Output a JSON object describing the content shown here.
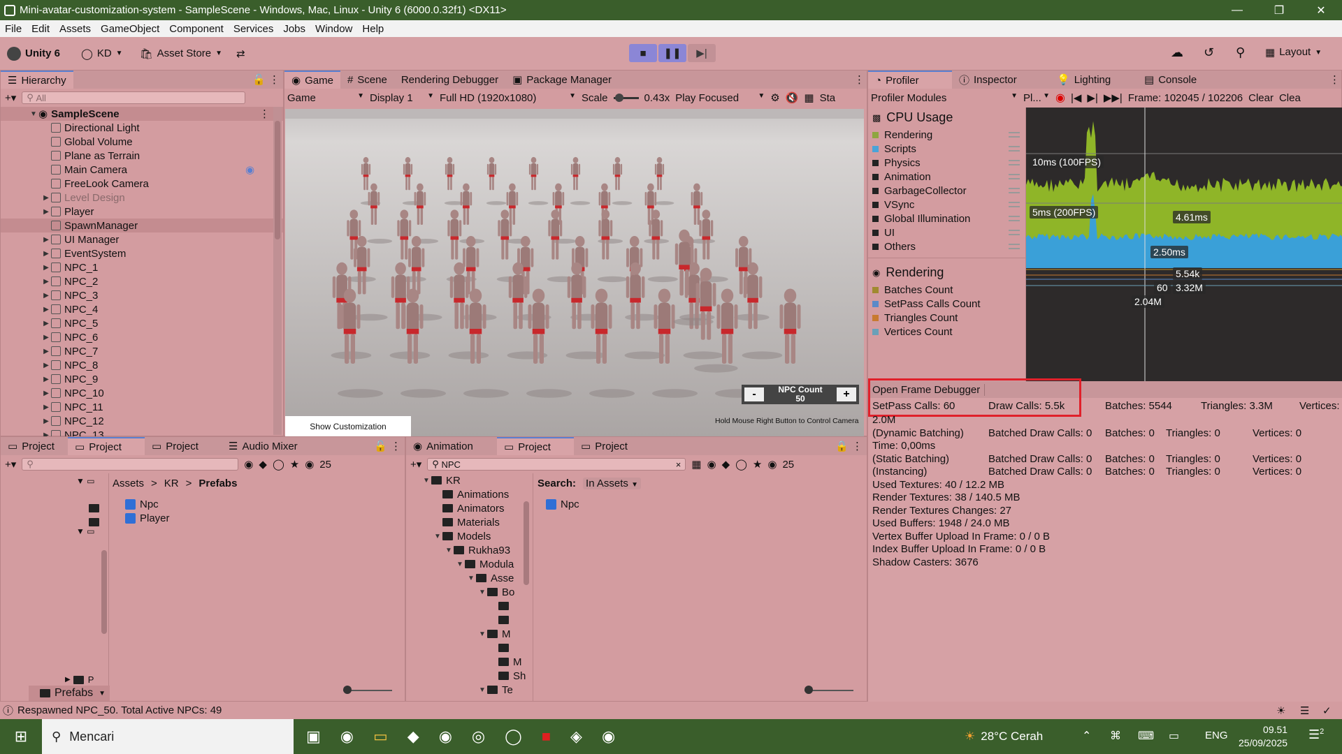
{
  "window": {
    "title": "Mini-avatar-customization-system - SampleScene - Windows, Mac, Linux - Unity 6 (6000.0.32f1) <DX11>"
  },
  "menu": [
    "File",
    "Edit",
    "Assets",
    "GameObject",
    "Component",
    "Services",
    "Jobs",
    "Window",
    "Help"
  ],
  "toolbar": {
    "unity_label": "Unity 6",
    "account": "KD",
    "asset_store": "Asset Store",
    "layout": "Layout"
  },
  "hierarchy": {
    "tab": "Hierarchy",
    "search_placeholder": "All",
    "scene": "SampleScene",
    "items": [
      "Directional Light",
      "Global Volume",
      "Plane as Terrain",
      "Main Camera",
      "FreeLook Camera",
      "Level Design",
      "Player",
      "SpawnManager",
      "UI Manager",
      "EventSystem",
      "NPC_1",
      "NPC_2",
      "NPC_3",
      "NPC_4",
      "NPC_5",
      "NPC_6",
      "NPC_7",
      "NPC_8",
      "NPC_9",
      "NPC_10",
      "NPC_11",
      "NPC_12",
      "NPC_13"
    ]
  },
  "center_tabs": [
    "Game",
    "Scene",
    "Rendering Debugger",
    "Package Manager"
  ],
  "game_bar": {
    "display_mode": "Game",
    "display": "Display 1",
    "resolution": "Full HD (1920x1080)",
    "scale_label": "Scale",
    "scale_value": "0.43x",
    "play_mode": "Play Focused",
    "stats": "Sta"
  },
  "game_overlay": {
    "npc_label": "NPC Count",
    "npc_value": "50",
    "minus": "-",
    "plus": "+",
    "show_btn": "Show Customization",
    "hint": "Hold Mouse Right Button to Control Camera"
  },
  "right_tabs": [
    "Profiler",
    "Inspector",
    "Lighting",
    "Console"
  ],
  "profiler": {
    "modules": "Profiler Modules",
    "pl": "Pl...",
    "frame": "Frame: 102045 / 102206",
    "clear": "Clear",
    "clear2": "Clea",
    "cpu_title": "CPU Usage",
    "cpu_items": [
      {
        "name": "Rendering",
        "color": "#8ea640"
      },
      {
        "name": "Scripts",
        "color": "#4aa3d8"
      },
      {
        "name": "Physics",
        "color": "#222222"
      },
      {
        "name": "Animation",
        "color": "#222222"
      },
      {
        "name": "GarbageCollector",
        "color": "#222222"
      },
      {
        "name": "VSync",
        "color": "#222222"
      },
      {
        "name": "Global Illumination",
        "color": "#222222"
      },
      {
        "name": "UI",
        "color": "#222222"
      },
      {
        "name": "Others",
        "color": "#222222"
      }
    ],
    "render_title": "Rendering",
    "render_items": [
      {
        "name": "Batches Count",
        "color": "#a08a30"
      },
      {
        "name": "SetPass Calls Count",
        "color": "#5a8ac8"
      },
      {
        "name": "Triangles Count",
        "color": "#c87a30"
      },
      {
        "name": "Vertices Count",
        "color": "#6aa0b8"
      }
    ],
    "chart_labels": {
      "l100": "10ms (100FPS)",
      "l200": "5ms (200FPS)",
      "v461": "4.61ms",
      "v250": "2.50ms",
      "v554": "5.54k",
      "v60": "60",
      "v332": "3.32M",
      "v204": "2.04M"
    },
    "open_fd": "Open Frame Debugger",
    "setpass": "SetPass Calls: 60",
    "drawcalls": "Draw Calls: 5.5k",
    "batches": "Batches: 5544",
    "triangles": "Triangles: 3.3M",
    "vertices": "Vertices:",
    "vert_val": "2.0M",
    "dyn": "(Dynamic Batching)",
    "dyn_bdc": "Batched Draw Calls: 0",
    "dyn_b": "Batches: 0",
    "dyn_t": "Triangles: 0",
    "dyn_v": "Vertices: 0",
    "time": "Time: 0,00ms",
    "stat": "(Static Batching)",
    "stat_bdc": "Batched Draw Calls: 0",
    "stat_b": "Batches: 0",
    "stat_t": "Triangles: 0",
    "stat_v": "Vertices: 0",
    "inst": "(Instancing)",
    "inst_bdc": "Batched Draw Calls: 0",
    "inst_b": "Batches: 0",
    "inst_t": "Triangles: 0",
    "inst_v": "Vertices: 0",
    "lines": [
      "Used Textures: 40 / 12.2 MB",
      "Render Textures: 38 / 140.5 MB",
      "Render Textures Changes: 27",
      "Used Buffers: 1948 / 24.0 MB",
      "Vertex Buffer Upload In Frame: 0 / 0 B",
      "Index Buffer Upload In Frame: 0 / 0 B",
      "Shadow Casters: 3676"
    ]
  },
  "bottom_left": {
    "tabs": [
      "Project",
      "Project",
      "Project",
      "Audio Mixer"
    ],
    "count": "25",
    "breadcrumb": [
      "Assets",
      "KR",
      "Prefabs"
    ],
    "assets": [
      "Npc",
      "Player"
    ],
    "folder_p": "P",
    "prefabs": "Prefabs"
  },
  "bottom_mid": {
    "tabs": [
      "Animation",
      "Project",
      "Project"
    ],
    "search": "NPC",
    "count": "25",
    "tree": [
      {
        "l": "KR",
        "d": 0
      },
      {
        "l": "Animations",
        "d": 1
      },
      {
        "l": "Animators",
        "d": 1
      },
      {
        "l": "Materials",
        "d": 1
      },
      {
        "l": "Models",
        "d": 1
      },
      {
        "l": "Rukha93",
        "d": 2
      },
      {
        "l": "Modula",
        "d": 3
      },
      {
        "l": "Asse",
        "d": 4
      },
      {
        "l": "Bo",
        "d": 5
      },
      {
        "l": "",
        "d": 6
      },
      {
        "l": "",
        "d": 6
      },
      {
        "l": "M",
        "d": 5
      },
      {
        "l": "",
        "d": 6
      },
      {
        "l": "M",
        "d": 6
      },
      {
        "l": "Sh",
        "d": 6
      },
      {
        "l": "Te",
        "d": 5
      }
    ],
    "search_label": "Search:",
    "search_scope": "In Assets",
    "result": "Npc"
  },
  "status": {
    "text": "Respawned NPC_50. Total Active NPCs: 49"
  },
  "taskbar": {
    "search": "Mencari",
    "weather": "28°C Cerah",
    "lang": "ENG",
    "time": "09.51",
    "date": "25/09/2025",
    "notif": "2"
  }
}
